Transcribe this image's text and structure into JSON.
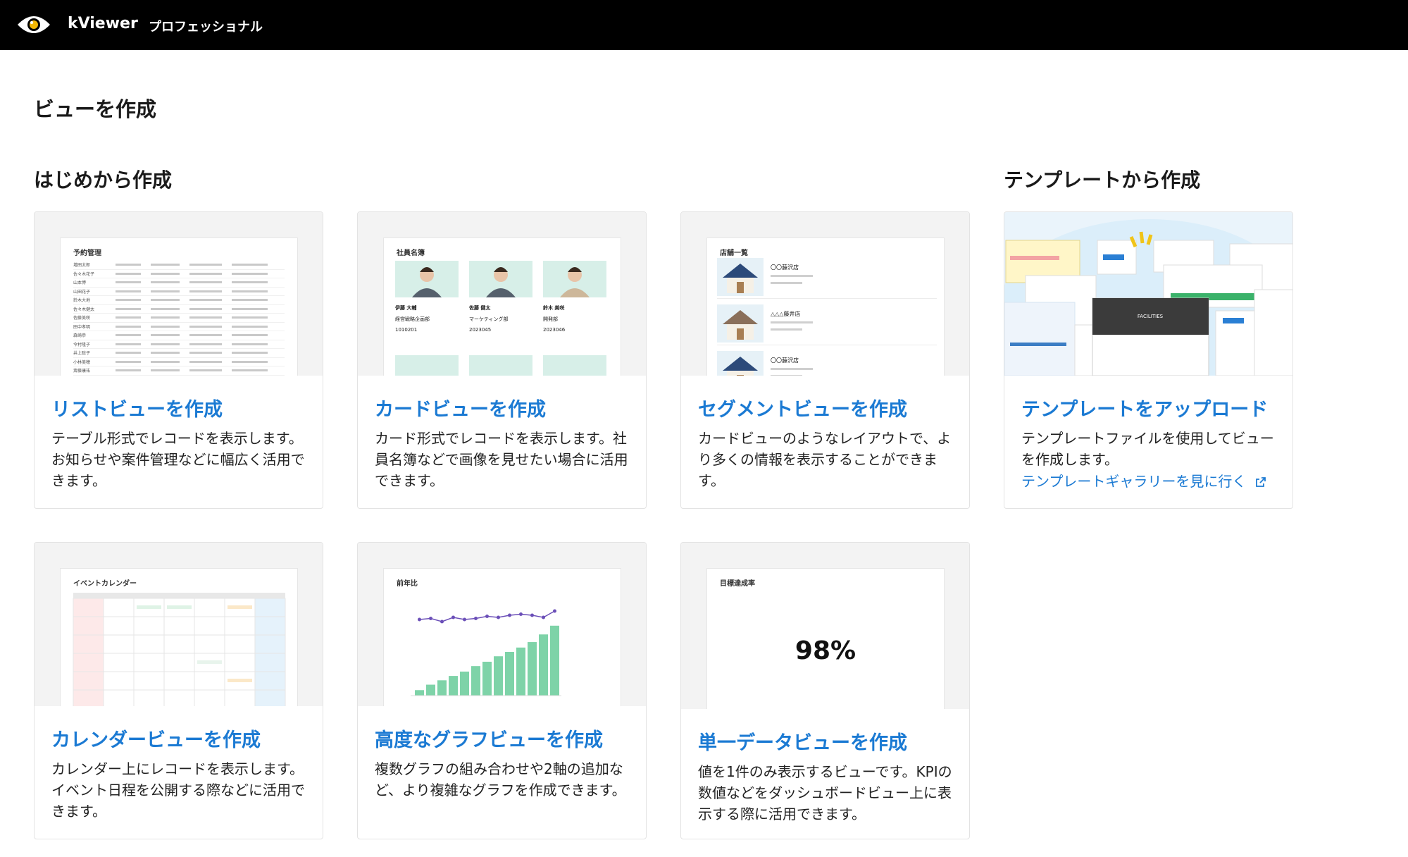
{
  "header": {
    "app_name": "kViewer",
    "edition": "プロフェッショナル"
  },
  "page_title": "ビューを作成",
  "sections": {
    "scratch": "はじめから作成",
    "template": "テンプレートから作成"
  },
  "cards": [
    {
      "title": "リストビューを作成",
      "desc": "テーブル形式でレコードを表示します。お知らせや案件管理などに幅広く活用できます。",
      "preview_title": "予約管理"
    },
    {
      "title": "カードビューを作成",
      "desc": "カード形式でレコードを表示します。社員名簿などで画像を見せたい場合に活用できます。",
      "preview_title": "社員名簿"
    },
    {
      "title": "セグメントビューを作成",
      "desc": "カードビューのようなレイアウトで、より多くの情報を表示することができます。",
      "preview_title": "店舗一覧"
    },
    {
      "title": "テンプレートをアップロード",
      "desc": "テンプレートファイルを使用してビューを作成します。",
      "link": "テンプレートギャラリーを見に行く"
    },
    {
      "title": "カレンダービューを作成",
      "desc": "カレンダー上にレコードを表示します。イベント日程を公開する際などに活用できます。",
      "preview_title": "イベントカレンダー"
    },
    {
      "title": "高度なグラフビューを作成",
      "desc": "複数グラフの組み合わせや2軸の追加など、より複雑なグラフを作成できます。",
      "preview_title": "前年比"
    },
    {
      "title": "単一データビューを作成",
      "desc": "値を1件のみ表示するビューです。KPIの数値などをダッシュボードビュー上に表示する際に活用できます。",
      "preview_title": "目標達成率",
      "kpi_value": "98%"
    }
  ],
  "previews": {
    "list_rows": [
      "増田太郎",
      "佐々木花子",
      "山本博",
      "山田花子",
      "鈴木大地",
      "佐々木健太",
      "佐藤美咲",
      "田中孝明",
      "森崎恭",
      "今村隆子",
      "井上聡子",
      "小林美穂",
      "斎藤康祐"
    ],
    "card_people": [
      {
        "name": "伊藤 大輔",
        "dept": "経営戦略企画部",
        "id": "1010201"
      },
      {
        "name": "佐藤 健太",
        "dept": "マーケティング部",
        "id": "2023045"
      },
      {
        "name": "鈴木 美咲",
        "dept": "開発部",
        "id": "2023046"
      }
    ],
    "segment_items": [
      "〇〇藤沢店",
      "△△△藤井店",
      "〇〇藤沢店"
    ],
    "template_thumb_label": "FACILITIES"
  },
  "colors": {
    "accent": "#1b7ad3",
    "bar": "#7ed3a8",
    "line": "#6b4fb8"
  }
}
